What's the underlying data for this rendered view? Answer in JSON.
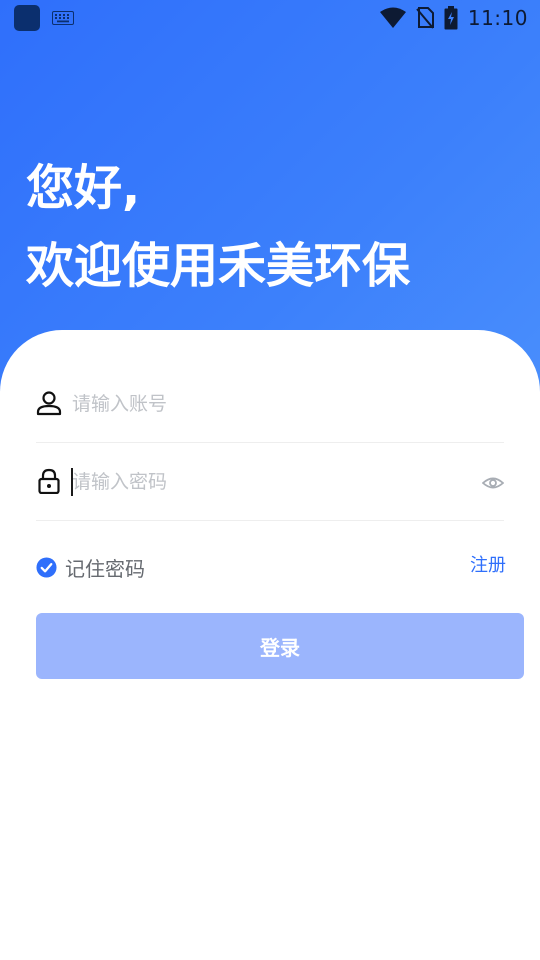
{
  "status_bar": {
    "time": "11:10",
    "icons": [
      "app-icon",
      "keyboard-icon",
      "wifi-icon",
      "no-sim-icon",
      "battery-charging-icon"
    ]
  },
  "header": {
    "line1": "您好,",
    "line2": "欢迎使用禾美环保"
  },
  "form": {
    "account": {
      "placeholder": "请输入账号",
      "value": "",
      "icon": "user-icon"
    },
    "password": {
      "placeholder": "请输入密码",
      "value": "",
      "icon": "lock-icon",
      "toggle_icon": "eye-icon"
    },
    "remember": {
      "label": "记住密码",
      "checked": true
    },
    "register_label": "注册",
    "login_label": "登录"
  },
  "colors": {
    "primary": "#2f6ffb",
    "button_disabled": "#9bb5fd",
    "placeholder": "#c0c3c8"
  }
}
